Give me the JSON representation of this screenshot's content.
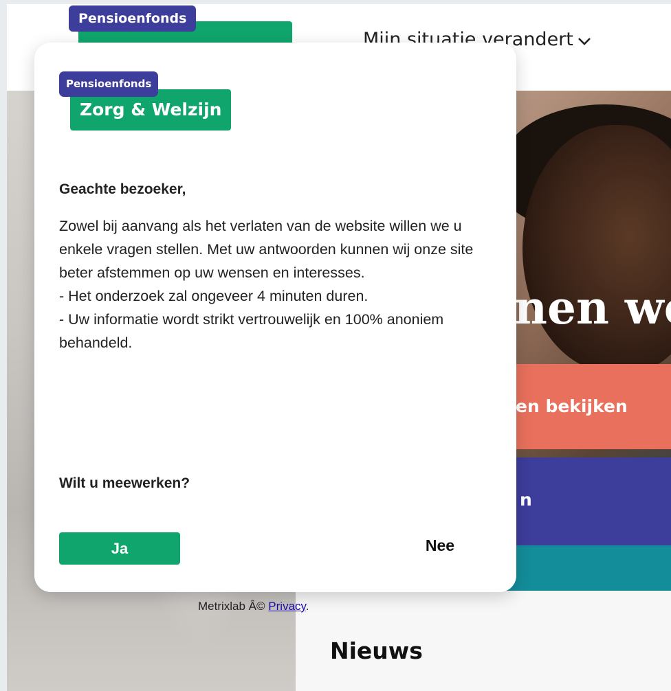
{
  "header": {
    "logo_tag": "Pensioenfonds",
    "nav_item": "Mijn situatie verandert"
  },
  "hero": {
    "title_fragment": "nnen we",
    "cta_primary": "en bekijken",
    "cta_secondary": "n"
  },
  "news": {
    "heading": "Nieuws"
  },
  "footer": {
    "credit": "Metrixlab Â©",
    "privacy_link": "Privacy",
    "period": "."
  },
  "modal": {
    "logo_tag": "Pensioenfonds",
    "logo_name": "Zorg & Welzijn",
    "greeting": "Geachte bezoeker,",
    "body_lines": [
      "Zowel bij aanvang als het verlaten van de website willen we u enkele vragen stellen. Met uw antwoorden kunnen wij onze site beter afstemmen op uw wensen en interesses.",
      "-   Het onderzoek zal ongeveer 4 minuten duren.",
      "-   Uw informatie wordt strikt vertrouwelijk en 100% anoniem behandeld."
    ],
    "question": "Wilt u meewerken?",
    "yes_label": "Ja",
    "no_label": "Nee"
  },
  "colors": {
    "brand_green": "#10a56d",
    "brand_purple": "#3d3d9b",
    "coral": "#e8705c"
  }
}
